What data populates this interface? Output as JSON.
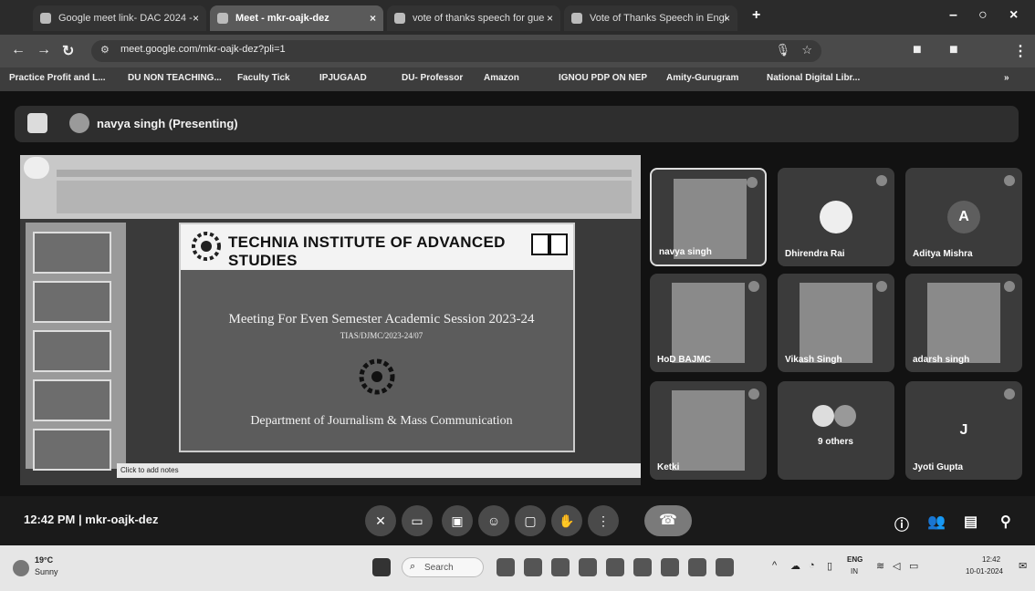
{
  "browser": {
    "tabs": [
      {
        "label": "Google meet link- DAC 2024 -"
      },
      {
        "label": "Meet - mkr-oajk-dez"
      },
      {
        "label": "vote of thanks speech for gue"
      },
      {
        "label": "Vote of Thanks Speech in Engl"
      }
    ],
    "url": "meet.google.com/mkr-oajk-dez?pli=1",
    "bookmarks": [
      "Practice Profit and L...",
      "DU NON TEACHING...",
      "Faculty Tick",
      "IPJUGAAD",
      "DU- Professor",
      "Amazon",
      "IGNOU PDP ON NEP",
      "Amity-Gurugram",
      "National Digital Libr..."
    ]
  },
  "meet": {
    "presenter": "navya singh (Presenting)",
    "slide": {
      "org": "TECHNIA INSTITUTE OF ADVANCED STUDIES",
      "meeting_title": "Meeting For Even Semester Academic Session 2023-24",
      "ref": "TIAS/DJMC/2023-24/07",
      "department": "Department of Journalism & Mass Communication",
      "notes_placeholder": "Click to add notes"
    },
    "participants": [
      {
        "name": "navya singh",
        "initial": ""
      },
      {
        "name": "Dhirendra Rai",
        "initial": ""
      },
      {
        "name": "Aditya Mishra",
        "initial": "A"
      },
      {
        "name": "HoD BAJMC",
        "initial": ""
      },
      {
        "name": "Vikash Singh",
        "initial": ""
      },
      {
        "name": "adarsh singh",
        "initial": ""
      },
      {
        "name": "Ketki",
        "initial": ""
      },
      {
        "name": "9 others",
        "initial": ""
      },
      {
        "name": "Jyoti Gupta",
        "initial": "J"
      }
    ],
    "clock": "12:42 PM",
    "separator": "|",
    "meeting_code": "mkr-oajk-dez"
  },
  "taskbar": {
    "weather_temp": "19°C",
    "weather_desc": "Sunny",
    "search": "Search",
    "lang": "ENG",
    "lang_sub": "IN",
    "time": "12:42",
    "date": "10-01-2024"
  }
}
